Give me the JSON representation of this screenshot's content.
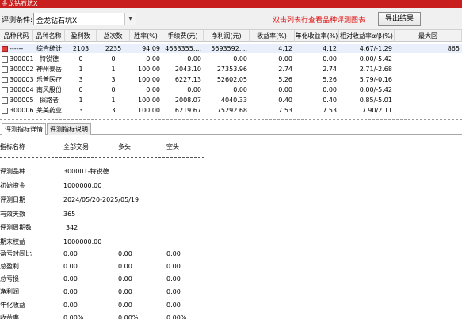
{
  "window": {
    "title": "金龙钻石坑X"
  },
  "toolbar": {
    "condition_label": "评测条件:",
    "condition_value": "金龙钻石坑X",
    "hint": "双击列表行查看品种评测图表",
    "export_label": "导出结果"
  },
  "table": {
    "columns": [
      "品种代码",
      "品种名称",
      "盈利数",
      "总次数",
      "胜率(%)",
      "手续费(元)",
      "净利润(元)",
      "收益率(%)",
      "年化收益率(%)",
      "相对收益率α/β(%)",
      "最大回"
    ],
    "rows": [
      [
        "------",
        "综合统计",
        "2103",
        "2235",
        "94.09",
        "4633355....",
        "5693592....",
        "4.12",
        "4.12",
        "4.67/-1.29",
        "865"
      ],
      [
        "300001",
        "特锐德",
        "0",
        "0",
        "0.00",
        "0.00",
        "0.00",
        "0.00",
        "0.00",
        "0.00/-5.42",
        ""
      ],
      [
        "300002",
        "神州泰岳",
        "1",
        "1",
        "100.00",
        "2043.10",
        "27353.96",
        "2.74",
        "2.74",
        "2.71/-2.68",
        ""
      ],
      [
        "300003",
        "乐普医疗",
        "3",
        "3",
        "100.00",
        "6227.13",
        "52602.05",
        "5.26",
        "5.26",
        "5.79/-0.16",
        ""
      ],
      [
        "300004",
        "南风股份",
        "0",
        "0",
        "0.00",
        "0.00",
        "0.00",
        "0.00",
        "0.00",
        "0.00/-5.42",
        ""
      ],
      [
        "300005",
        "探路者",
        "1",
        "1",
        "100.00",
        "2008.07",
        "4040.33",
        "0.40",
        "0.40",
        "0.85/-5.01",
        ""
      ],
      [
        "300006",
        "莱美药业",
        "3",
        "3",
        "100.00",
        "6219.67",
        "75292.68",
        "7.53",
        "7.53",
        "7.90/2.11",
        ""
      ]
    ]
  },
  "tabs": [
    "评测指标详情",
    "评测指标说明"
  ],
  "detail": {
    "header": {
      "name": "指标名称",
      "all": "全部交易",
      "long": "多头",
      "short": "空头"
    },
    "metrics": [
      {
        "label": "评测品种",
        "all": "300001-特锐德",
        "long": "",
        "short": ""
      },
      {
        "label": "初始资金",
        "all": "1000000.00",
        "long": "",
        "short": ""
      },
      {
        "label": "评测日期",
        "all": "2024/05/20-2025/05/19",
        "long": "",
        "short": ""
      },
      {
        "label": "有效天数",
        "all": "365",
        "long": "",
        "short": ""
      },
      {
        "label": "评测周期数",
        "all": "342",
        "long": "",
        "short": ""
      },
      {
        "label": "期末权益",
        "all": "1000000.00",
        "long": "",
        "short": ""
      },
      {
        "label": "盈亏时间比",
        "all": "0.00",
        "long": "0.00",
        "short": "0.00"
      },
      {
        "label": "总盈利",
        "all": "0.00",
        "long": "0.00",
        "short": "0.00"
      },
      {
        "label": "总亏损",
        "all": "0.00",
        "long": "0.00",
        "short": "0.00"
      },
      {
        "label": "净利润",
        "all": "0.00",
        "long": "0.00",
        "short": "0.00"
      },
      {
        "label": "年化收益",
        "all": "0.00",
        "long": "0.00",
        "short": "0.00"
      },
      {
        "label": "收益率",
        "all": "0.00%",
        "long": "0.00%",
        "short": "0.00%"
      }
    ]
  },
  "colors": {
    "titlebar": "#c81e1e",
    "hint": "#e01010",
    "selected_row": "#eaf0fb",
    "marker": "#e04040"
  }
}
